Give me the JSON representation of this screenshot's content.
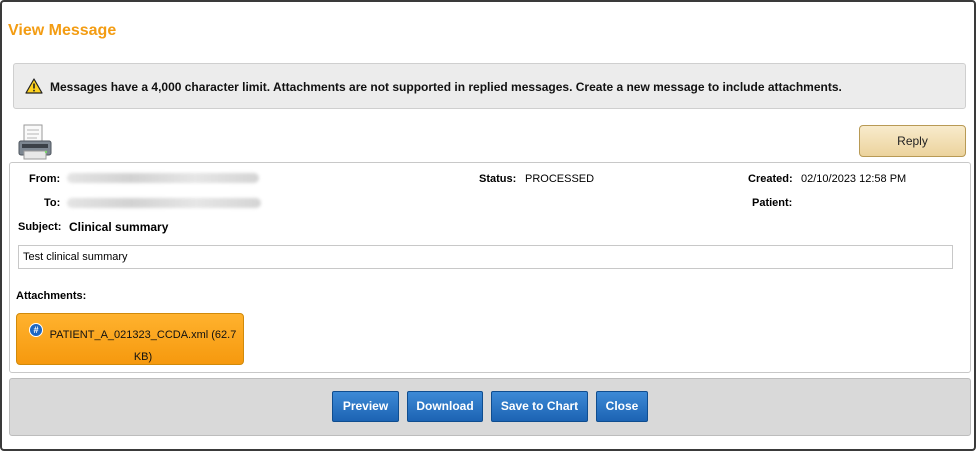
{
  "title": "View Message",
  "notice": {
    "icon": "warning-icon",
    "text": "Messages have a 4,000 character limit. Attachments are not supported in replied messages. Create a new message to include attachments."
  },
  "toolbar": {
    "print_icon": "printer-icon",
    "reply_label": "Reply"
  },
  "message": {
    "from_label": "From:",
    "to_label": "To:",
    "status_label": "Status:",
    "status_value": "PROCESSED",
    "created_label": "Created:",
    "created_value": "02/10/2023 12:58 PM",
    "patient_label": "Patient:",
    "patient_value": "",
    "subject_label": "Subject:",
    "subject_value": "Clinical summary",
    "body": "Test clinical summary",
    "attachments_label": "Attachments:",
    "attachment": {
      "icon": "hash-icon",
      "name": "PATIENT_A_021323_CCDA.xml (62.7 KB)"
    }
  },
  "actions": {
    "preview": "Preview",
    "download": "Download",
    "save_to_chart": "Save to Chart",
    "close": "Close"
  },
  "colors": {
    "title": "#f39c12",
    "attachment": "#f6990e",
    "button": "#1c63b3",
    "reply": "#ecd39d"
  }
}
